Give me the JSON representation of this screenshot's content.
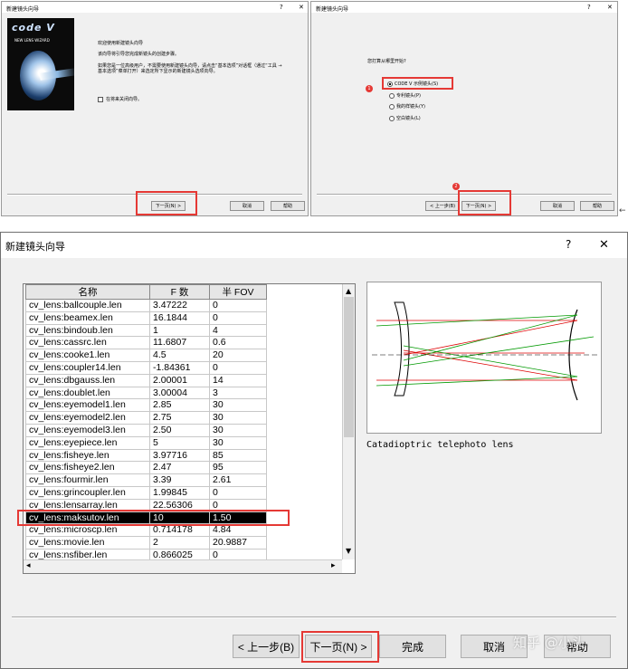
{
  "top_left": {
    "title": "新建镜头向导",
    "logo_text": "NEW LENS WIZARD",
    "logo_brand": "code V",
    "welcome": "欢迎使用新建镜头向导",
    "line1": "该向导将引导您完成新镜头的创建步骤。",
    "line2": "如果您是一位高级用户，不需要使用新建镜头向导，请点击“基本选项”对话框（通过“工具 → 基本选项”菜单打开）来选定所下显示的新建镜头选项向导。",
    "checkbox_label": "在将来关闭向导。",
    "next": "下一页(N) >",
    "cancel": "取消",
    "help": "帮助"
  },
  "top_right": {
    "title": "新建镜头向导",
    "question": "您打算从哪里开始?",
    "options": [
      "CODE V 示例镜头(S)",
      "专利镜头(P)",
      "我的样镜头(Y)",
      "空白镜头(L)"
    ],
    "back": "< 上一步(B)",
    "next": "下一页(N) >",
    "cancel": "取消",
    "help": "帮助",
    "markers": [
      "1",
      "2"
    ]
  },
  "main": {
    "title": "新建镜头向导",
    "help_q": "?",
    "close": "✕",
    "columns": [
      "名称",
      "F 数",
      "半 FOV"
    ],
    "rows": [
      [
        "cv_lens:ballcouple.len",
        "3.47222",
        "0"
      ],
      [
        "cv_lens:beamex.len",
        "16.1844",
        "0"
      ],
      [
        "cv_lens:bindoub.len",
        "1",
        "4"
      ],
      [
        "cv_lens:cassrc.len",
        "11.6807",
        "0.6"
      ],
      [
        "cv_lens:cooke1.len",
        "4.5",
        "20"
      ],
      [
        "cv_lens:coupler14.len",
        "-1.84361",
        "0"
      ],
      [
        "cv_lens:dbgauss.len",
        "2.00001",
        "14"
      ],
      [
        "cv_lens:doublet.len",
        "3.00004",
        "3"
      ],
      [
        "cv_lens:eyemodel1.len",
        "2.85",
        "30"
      ],
      [
        "cv_lens:eyemodel2.len",
        "2.75",
        "30"
      ],
      [
        "cv_lens:eyemodel3.len",
        "2.50",
        "30"
      ],
      [
        "cv_lens:eyepiece.len",
        "5",
        "30"
      ],
      [
        "cv_lens:fisheye.len",
        "3.97716",
        "85"
      ],
      [
        "cv_lens:fisheye2.len",
        "2.47",
        "95"
      ],
      [
        "cv_lens:fourmir.len",
        "3.39",
        "2.61"
      ],
      [
        "cv_lens:grincoupler.len",
        "1.99845",
        "0"
      ],
      [
        "cv_lens:lensarray.len",
        "22.56306",
        "0"
      ],
      [
        "cv_lens:maksutov.len",
        "10",
        "1.50"
      ],
      [
        "cv_lens:microscp.len",
        "0.714178",
        "4.84"
      ],
      [
        "cv_lens:movie.len",
        "2",
        "20.9887"
      ],
      [
        "cv_lens:nsfiber.len",
        "0.866025",
        "0"
      ]
    ],
    "selected_index": 17,
    "preview_caption": "Catadioptric telephoto lens",
    "back": "< 上一步(B)",
    "next": "下一页(N) >",
    "finish": "完成",
    "cancel": "取消",
    "help": "帮助",
    "watermark": "知乎 @小头"
  }
}
